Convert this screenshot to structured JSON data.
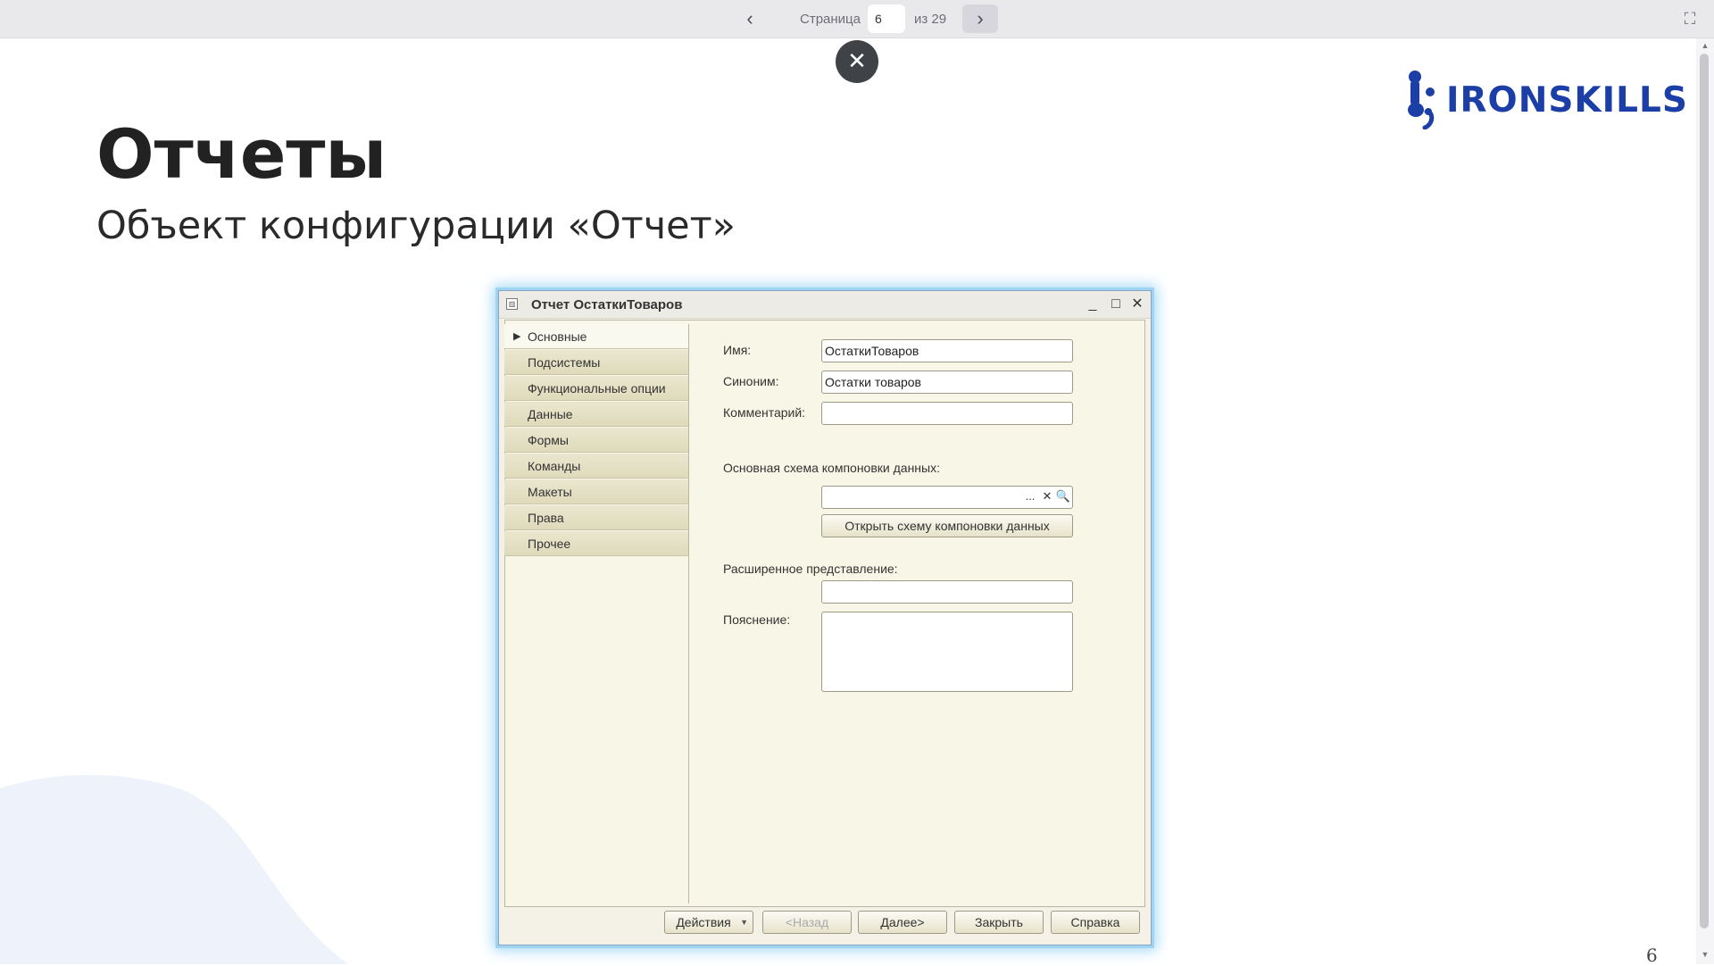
{
  "viewer": {
    "page_label": "Страница",
    "page_value": "6",
    "of_label": "из 29",
    "prev_icon": "‹",
    "next_icon": "›",
    "fullscreen_icon": "⛶",
    "close_icon": "✕"
  },
  "slide": {
    "title": "Отчеты",
    "subtitle": "Объект конфигурации «Отчет»",
    "logo_text": "IRONSKILLS",
    "page_number": "6",
    "accent_color": "#1b3fa6"
  },
  "window": {
    "title": "Отчет ОстаткиТоваров",
    "minimize_icon": "_",
    "maximize_icon": "□",
    "close_icon": "✕",
    "sidebar": [
      {
        "label": "Основные",
        "active": true
      },
      {
        "label": "Подсистемы"
      },
      {
        "label": "Функциональные опции"
      },
      {
        "label": "Данные"
      },
      {
        "label": "Формы"
      },
      {
        "label": "Команды"
      },
      {
        "label": "Макеты"
      },
      {
        "label": "Права"
      },
      {
        "label": "Прочее"
      }
    ],
    "fields": {
      "name_label": "Имя:",
      "name_value": "ОстаткиТоваров",
      "synonym_label": "Синоним:",
      "synonym_value": "Остатки товаров",
      "comment_label": "Комментарий:",
      "comment_value": "",
      "schema_label": "Основная схема компоновки данных:",
      "schema_value": "",
      "schema_select_icon": "...",
      "schema_clear_icon": "✕",
      "schema_open_icon": "🔍",
      "open_schema_button": "Открыть схему компоновки данных",
      "extended_label": "Расширенное представление:",
      "extended_value": "",
      "explanation_label": "Пояснение:",
      "explanation_value": ""
    },
    "buttons": {
      "actions": "Действия",
      "back": "<Назад",
      "next": "Далее>",
      "close": "Закрыть",
      "help": "Справка"
    }
  }
}
